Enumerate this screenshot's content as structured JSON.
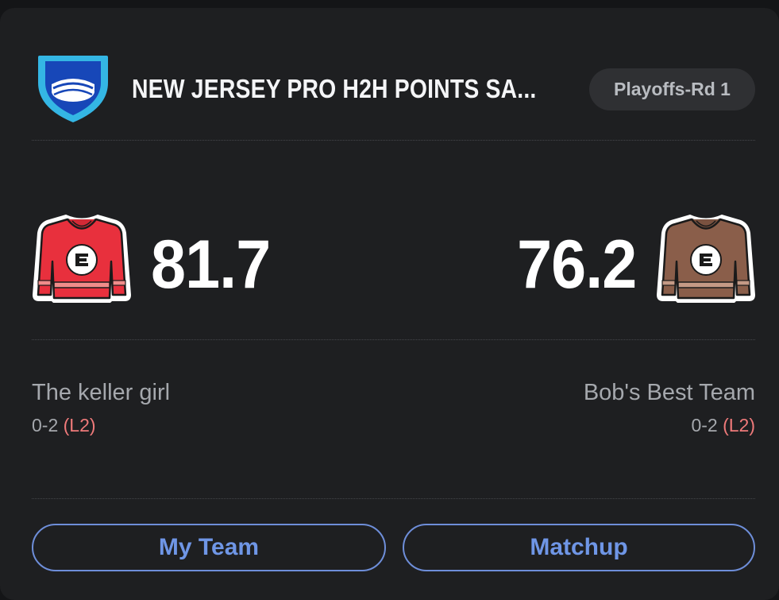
{
  "league": {
    "name": "NEW JERSEY PRO H2H POINTS SA...",
    "round": "Playoffs-Rd 1",
    "logo_icon": "hockey-puck-shield-icon"
  },
  "home": {
    "score": "81.7",
    "team_name": "The keller girl",
    "record": "0-2",
    "streak": "(L2)",
    "jersey_icon": "red-jersey-icon",
    "jersey_color": "#e8303d"
  },
  "away": {
    "score": "76.2",
    "team_name": "Bob's Best Team",
    "record": "0-2",
    "streak": "(L2)",
    "jersey_icon": "brown-jersey-icon",
    "jersey_color": "#8a5e4a"
  },
  "buttons": {
    "my_team": "My Team",
    "matchup": "Matchup"
  },
  "colors": {
    "accent": "#6f96e6",
    "streak_loss": "#ef7a7a",
    "background": "#1e1f21"
  }
}
